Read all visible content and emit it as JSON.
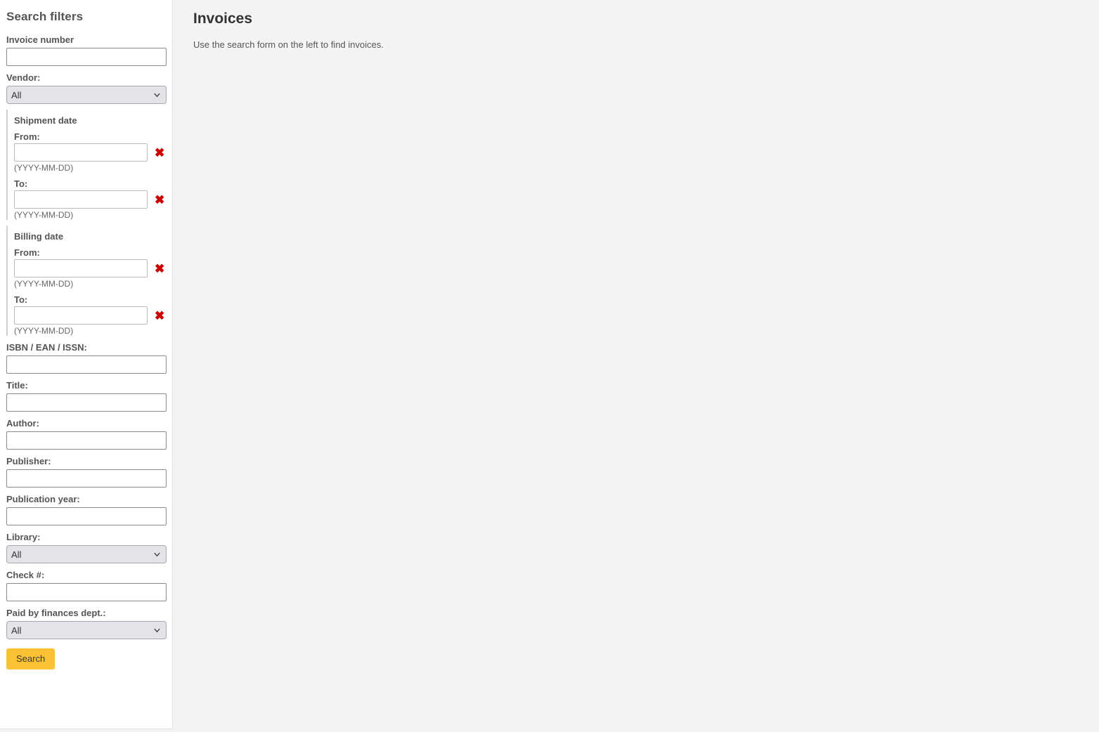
{
  "sidebar": {
    "title": "Search filters",
    "invoice_number": {
      "label": "Invoice number",
      "value": "",
      "placeholder": ""
    },
    "vendor": {
      "label": "Vendor:",
      "value": "All",
      "options": [
        "All"
      ]
    },
    "shipment_date": {
      "title": "Shipment date",
      "from_label": "From:",
      "from_value": "",
      "from_hint": "(YYYY-MM-DD)",
      "to_label": "To:",
      "to_value": "",
      "to_hint": "(YYYY-MM-DD)",
      "clear_icon": "red-x-icon"
    },
    "billing_date": {
      "title": "Billing date",
      "from_label": "From:",
      "from_value": "",
      "from_hint": "(YYYY-MM-DD)",
      "to_label": "To:",
      "to_value": "",
      "to_hint": "(YYYY-MM-DD)",
      "clear_icon": "red-x-icon"
    },
    "isbn": {
      "label": "ISBN / EAN / ISSN:",
      "value": ""
    },
    "title_field": {
      "label": "Title:",
      "value": ""
    },
    "author": {
      "label": "Author:",
      "value": ""
    },
    "publisher": {
      "label": "Publisher:",
      "value": ""
    },
    "publication_year": {
      "label": "Publication year:",
      "value": ""
    },
    "library": {
      "label": "Library:",
      "value": "All",
      "options": [
        "All"
      ]
    },
    "check_number": {
      "label": "Check #:",
      "value": ""
    },
    "paid_by_finances": {
      "label": "Paid by finances dept.:",
      "value": "All",
      "options": [
        "All"
      ]
    },
    "search_button": "Search",
    "clear_glyph": "✖",
    "chevron_icon": "chevron-down-icon"
  },
  "main": {
    "title": "Invoices",
    "subtitle": "Use the search form on the left to find invoices."
  },
  "colors": {
    "accent_button": "#fcc134",
    "clear_icon": "#cc0000",
    "sidebar_bg": "#ffffff",
    "main_bg": "#f4f4f4",
    "label_text": "#555555"
  }
}
